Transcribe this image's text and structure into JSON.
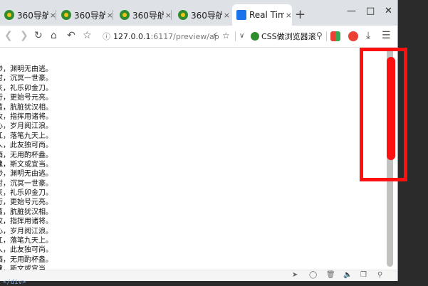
{
  "tabs": [
    {
      "title": "360导航_",
      "close": "×",
      "active": false
    },
    {
      "title": "360导航_",
      "close": "×",
      "active": false
    },
    {
      "title": "360导航_",
      "close": "×",
      "active": false
    },
    {
      "title": "360导航_",
      "close": "×",
      "active": false
    },
    {
      "title": "Real Tim",
      "close": "×",
      "active": true
    }
  ],
  "tabbar": {
    "new_tab": "+",
    "minimize": "—",
    "maximize": "□",
    "close": "✕"
  },
  "toolbar": {
    "url_host": "127.0.0.1",
    "url_path": ":6117/preview/ap",
    "search_text": "CSS做浏览器滚"
  },
  "poem_lines": [
    "渺，渊明无由逃。",
    "时，沉冥一世豪。",
    "灰，礼乐卯金刀。",
    "行，更始号元亮。",
    "葛，肮脏犹汉相。",
    "牧，指挥用诸将。",
    "心，岁月阅江浪。",
    "江，落笔九天上。",
    "人，此友独可尚。",
    "酒，无用酌杯盎。",
    "魂，斯文或宜当。",
    "渺，渊明无由逃。",
    "时，沉冥一世豪。",
    "灰，礼乐卯金刀。",
    "行，更始号元亮。",
    "葛，肮脏犹汉相。",
    "牧，指挥用诸将。",
    "心，岁月阅江浪。",
    "江，落笔九天上。",
    "人，此友独可尚。",
    "酒，无用酌杯盎。",
    "魂，斯文或宜当"
  ],
  "bottom_code": "</div>",
  "colors": {
    "highlight": "#ff1010",
    "active_tab_icon": "#1a73e8"
  }
}
